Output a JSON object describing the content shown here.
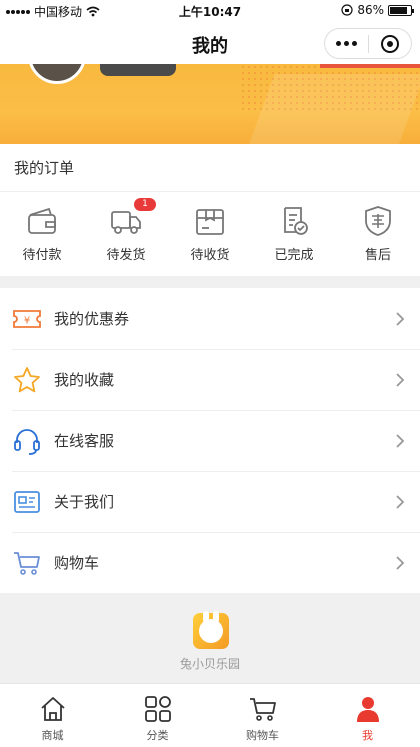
{
  "status_bar": {
    "carrier": "中国移动",
    "time": "上午10:47",
    "battery": "86%",
    "battery_level": 0.86,
    "icons": [
      "signal-icon",
      "wifi-icon",
      "orientation-lock-icon",
      "battery-icon"
    ]
  },
  "nav": {
    "title": "我的",
    "icons": [
      "more-icon",
      "close-mini-program-icon"
    ]
  },
  "orders": {
    "title": "我的订单",
    "items": [
      {
        "label": "待付款",
        "icon": "wallet-icon",
        "badge": ""
      },
      {
        "label": "待发货",
        "icon": "truck-icon",
        "badge": "1"
      },
      {
        "label": "待收货",
        "icon": "package-icon",
        "badge": ""
      },
      {
        "label": "已完成",
        "icon": "completed-doc-icon",
        "badge": ""
      },
      {
        "label": "售后",
        "icon": "after-sale-shield-icon",
        "badge": ""
      }
    ]
  },
  "menu": {
    "items": [
      {
        "label": "我的优惠券",
        "icon": "coupon-icon"
      },
      {
        "label": "我的收藏",
        "icon": "star-icon"
      },
      {
        "label": "在线客服",
        "icon": "headset-icon"
      },
      {
        "label": "关于我们",
        "icon": "about-card-icon"
      },
      {
        "label": "购物车",
        "icon": "cart-icon"
      }
    ]
  },
  "brand": {
    "name": "兔小贝乐园",
    "icon": "bunny-logo"
  },
  "tabbar": {
    "active": 3,
    "items": [
      {
        "label": "商城",
        "icon": "home-icon"
      },
      {
        "label": "分类",
        "icon": "category-icon"
      },
      {
        "label": "购物车",
        "icon": "cart-icon"
      },
      {
        "label": "我",
        "icon": "user-icon"
      }
    ]
  },
  "colors": {
    "accent": "#e83a2f",
    "banner": "#fbbe46",
    "badge": "#e93a3a"
  }
}
